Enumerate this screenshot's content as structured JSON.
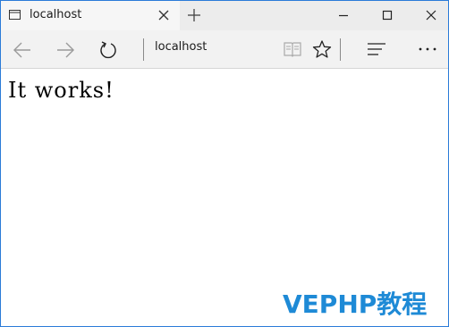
{
  "tab": {
    "title": "localhost",
    "icon": "page-icon"
  },
  "window_controls": {
    "minimize_icon": "minimize-icon",
    "maximize_icon": "maximize-icon",
    "close_icon": "close-icon"
  },
  "navbar": {
    "address": "localhost",
    "icons": [
      "back-arrow-icon",
      "forward-arrow-icon",
      "refresh-icon",
      "reading-view-icon",
      "favorite-star-icon",
      "hub-icon",
      "more-icon"
    ]
  },
  "page": {
    "heading": "It works!"
  },
  "watermark": {
    "text": "VEPHP教程"
  },
  "colors": {
    "accent": "#2b7bd8",
    "watermark": "#1e8ad6",
    "titlebar": "#ececec",
    "navbar": "#f2f2f2"
  }
}
